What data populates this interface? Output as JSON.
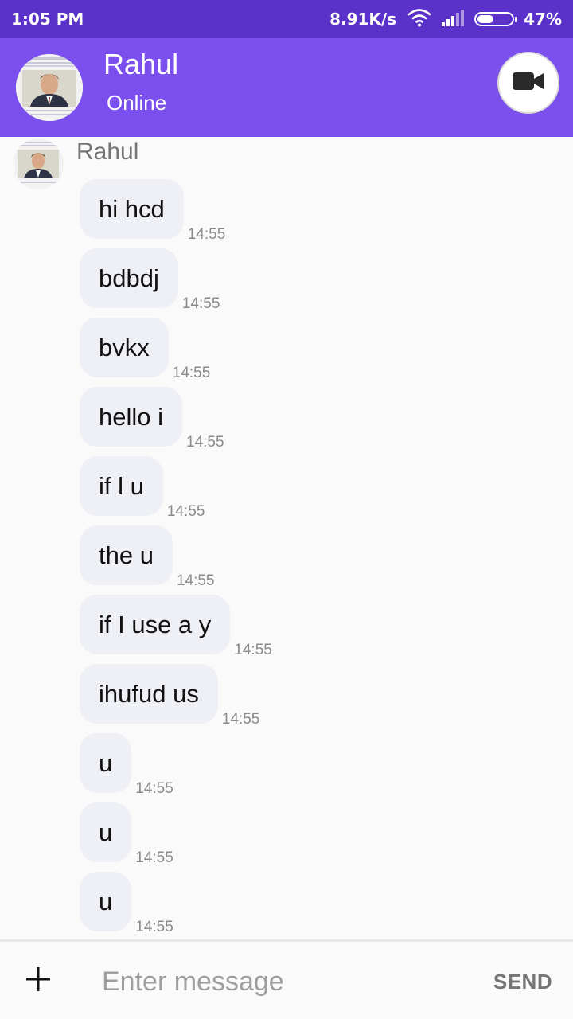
{
  "status_bar": {
    "time": "1:05 PM",
    "network_speed": "8.91K/s",
    "battery_percent": "47%",
    "battery_level": 0.47,
    "icons": [
      "wifi-icon",
      "signal-icon",
      "battery-icon"
    ]
  },
  "header": {
    "contact_name": "Rahul",
    "status": "Online",
    "background_color": "#7b4fee",
    "video_call_icon": "video-camera-icon"
  },
  "thread": {
    "sender_name": "Rahul",
    "messages": [
      {
        "text": "hi hcd",
        "time": "14:55"
      },
      {
        "text": "bdbdj",
        "time": "14:55"
      },
      {
        "text": "bvkx",
        "time": "14:55"
      },
      {
        "text": "hello i",
        "time": "14:55"
      },
      {
        "text": "if l u",
        "time": "14:55"
      },
      {
        "text": "the u",
        "time": "14:55"
      },
      {
        "text": "if I use a y",
        "time": "14:55"
      },
      {
        "text": "ihufud us",
        "time": "14:55"
      },
      {
        "text": "u",
        "time": "14:55"
      },
      {
        "text": "u",
        "time": "14:55"
      },
      {
        "text": "u",
        "time": "14:55"
      }
    ]
  },
  "composer": {
    "add_icon": "plus-icon",
    "placeholder": "Enter message",
    "value": "",
    "send_label": "SEND"
  }
}
